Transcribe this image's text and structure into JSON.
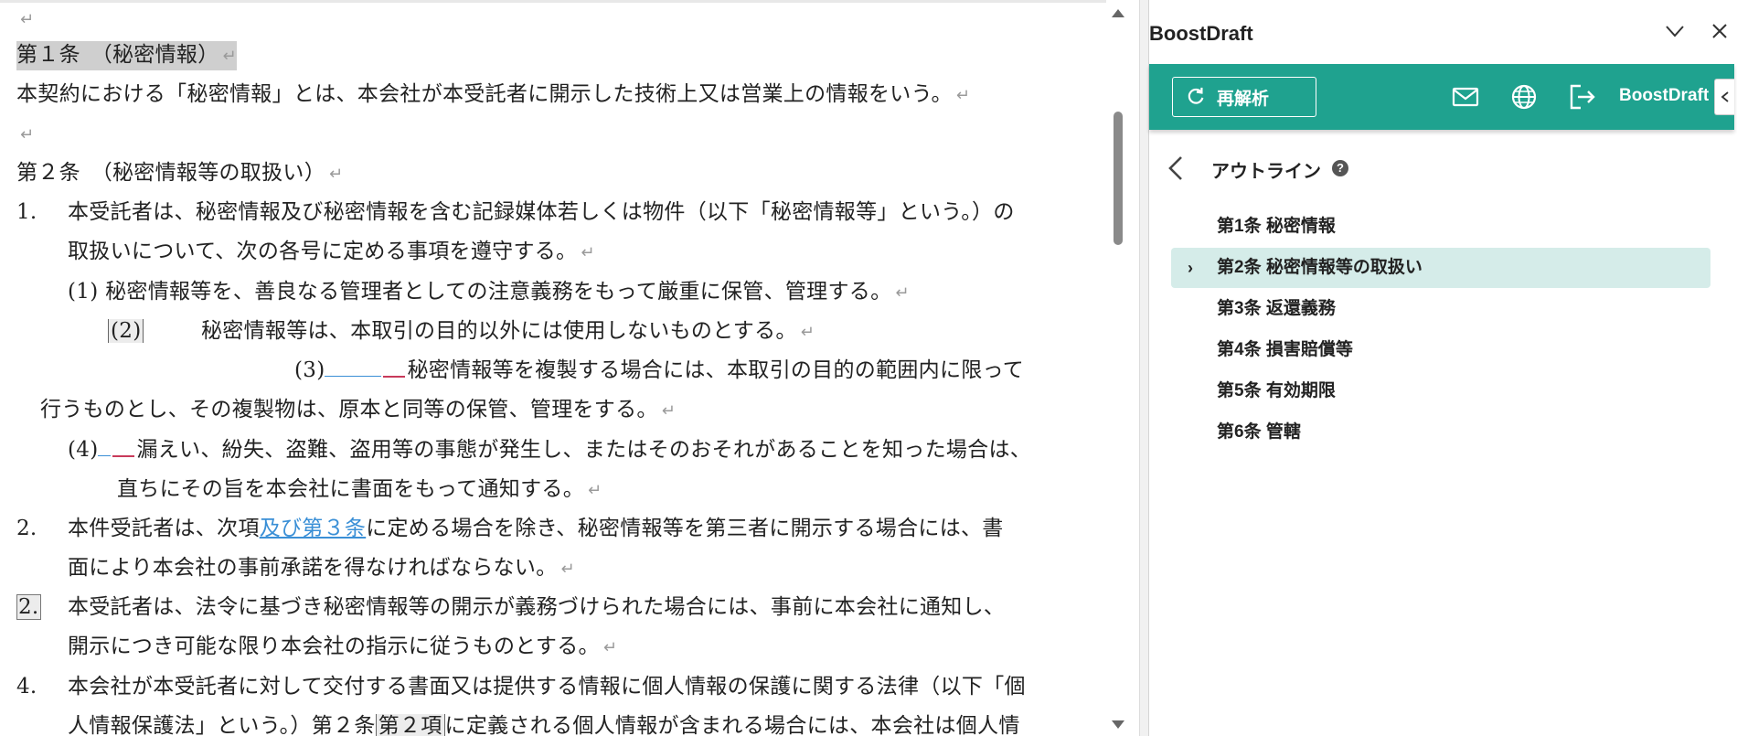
{
  "document": {
    "lines": [
      {
        "text": ""
      },
      {
        "text": "第１条　（秘密情報）"
      },
      {
        "text": "本契約における「秘密情報」とは、本会社が本受託者に開示した技術上又は営業上の情報をいう。"
      },
      {
        "text": ""
      },
      {
        "text": "第２条　（秘密情報等の取扱い）"
      },
      {
        "num": "1.",
        "text": "本受託者は、秘密情報及び秘密情報を含む記録媒体若しくは物件（以下「秘密情報等」という。）の"
      },
      {
        "text": "取扱いについて、次の各号に定める事項を遵守する。"
      },
      {
        "num": "(1)",
        "text": "秘密情報等を、善良なる管理者としての注意義務をもって厳重に保管、管理する。"
      },
      {
        "num": "(2)",
        "text": "秘密情報等は、本取引の目的以外には使用しないものとする。"
      },
      {
        "num": "(3)",
        "text": "秘密情報等を複製する場合には、本取引の目的の範囲内に限って"
      },
      {
        "text": "行うものとし、その複製物は、原本と同等の保管、管理をする。"
      },
      {
        "num": "(4)",
        "text": "漏えい、紛失、盗難、盗用等の事態が発生し、またはそのおそれがあることを知った場合は、"
      },
      {
        "text": "直ちにその旨を本会社に書面をもって通知する。"
      },
      {
        "num": "2.",
        "text_before": "本件受託者は、次項",
        "link": "及び第３条",
        "text_after": "に定める場合を除き、秘密情報等を第三者に開示する場合には、書"
      },
      {
        "text": "面により本会社の事前承諾を得なければならない。"
      },
      {
        "num": "2.",
        "text": "本受託者は、法令に基づき秘密情報等の開示が義務づけられた場合には、事前に本会社に通知し、"
      },
      {
        "text": "開示につき可能な限り本会社の指示に従うものとする。"
      },
      {
        "num": "4.",
        "text": "本会社が本受託者に対して交付する書面又は提供する情報に個人情報の保護に関する法律（以下「個"
      },
      {
        "text_before": "人情報保護法」という。）第２条",
        "boxed": "第２項",
        "text_after": "に定義される個人情報が含まれる場合には、本会社は個人情"
      }
    ]
  },
  "panel": {
    "title": "BoostDraft",
    "reanalyze_label": "再解析",
    "brand_label": "BoostDraft",
    "outline_title": "アウトライン",
    "help_glyph": "?",
    "expand_glyph": "›",
    "outline_items": [
      {
        "label": "第1条 秘密情報"
      },
      {
        "label": "第2条 秘密情報等の取扱い"
      },
      {
        "label": "第3条 返還義務"
      },
      {
        "label": "第4条 損害賠償等"
      },
      {
        "label": "第5条 有効期限"
      },
      {
        "label": "第6条 管轄"
      }
    ]
  },
  "colors": {
    "accent": "#1fa28f",
    "active_item": "#d5ece9",
    "link": "#3a8fd6",
    "change_mark": "#c83a5a"
  },
  "icons": [
    "refresh-icon",
    "mail-icon",
    "globe-icon",
    "logout-icon",
    "chevron-down-icon",
    "close-icon",
    "chevron-left-icon",
    "help-icon"
  ]
}
